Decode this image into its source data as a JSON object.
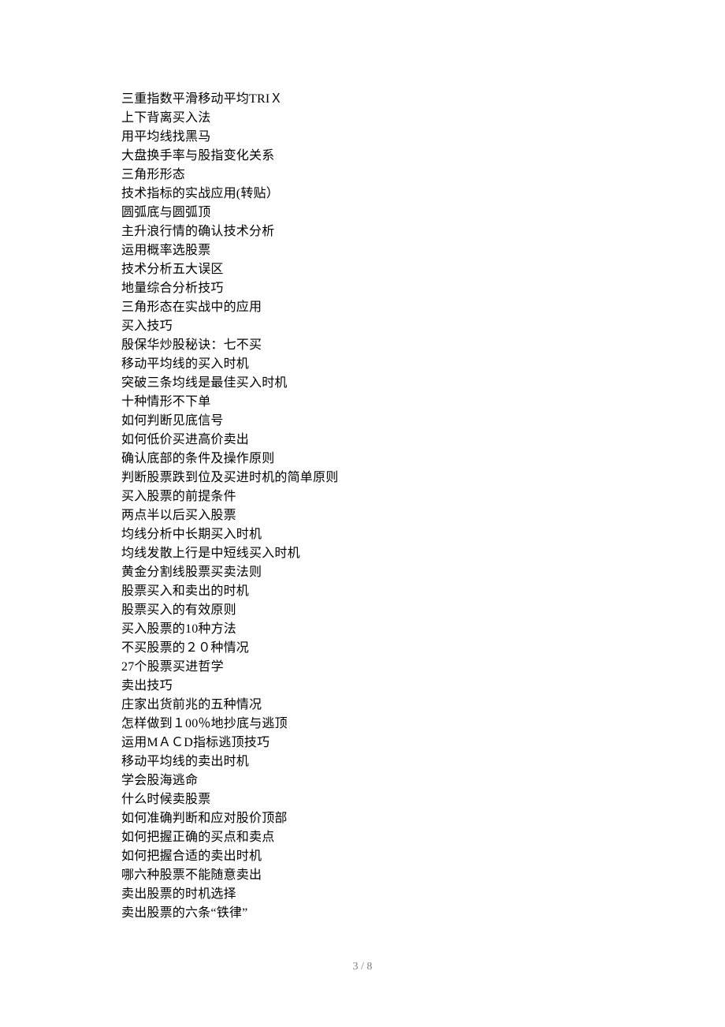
{
  "page_number": "3 / 8",
  "lines": [
    "三重指数平滑移动平均TRIＸ",
    "上下背离买入法",
    "用平均线找黑马",
    "大盘换手率与股指变化关系",
    "三角形形态",
    "技术指标的实战应用(转贴）",
    "圆弧底与圆弧顶",
    "主升浪行情的确认技术分析",
    "运用概率选股票",
    "技术分析五大误区",
    "地量综合分析技巧",
    "三角形态在实战中的应用",
    "买入技巧",
    "殷保华炒股秘诀：七不买",
    "移动平均线的买入时机",
    "突破三条均线是最佳买入时机",
    "十种情形不下单",
    "如何判断见底信号",
    "如何低价买进高价卖出",
    "确认底部的条件及操作原则",
    "判断股票跌到位及买进时机的简单原则",
    "买入股票的前提条件",
    "两点半以后买入股票",
    "均线分析中长期买入时机",
    "均线发散上行是中短线买入时机",
    "黄金分割线股票买卖法则",
    "股票买入和卖出的时机",
    "股票买入的有效原则",
    "买入股票的10种方法",
    "不买股票的２０种情况",
    "27个股票买进哲学",
    "卖出技巧",
    "庄家出货前兆的五种情况",
    "怎样做到１00％地抄底与逃顶",
    "运用MＡＣD指标逃顶技巧",
    "移动平均线的卖出时机",
    "学会股海逃命",
    "什么时候卖股票",
    "如何准确判断和应对股价顶部",
    "如何把握正确的买点和卖点",
    "如何把握合适的卖出时机",
    "哪六种股票不能随意卖出",
    "卖出股票的时机选择",
    "卖出股票的六条“铁律”"
  ]
}
